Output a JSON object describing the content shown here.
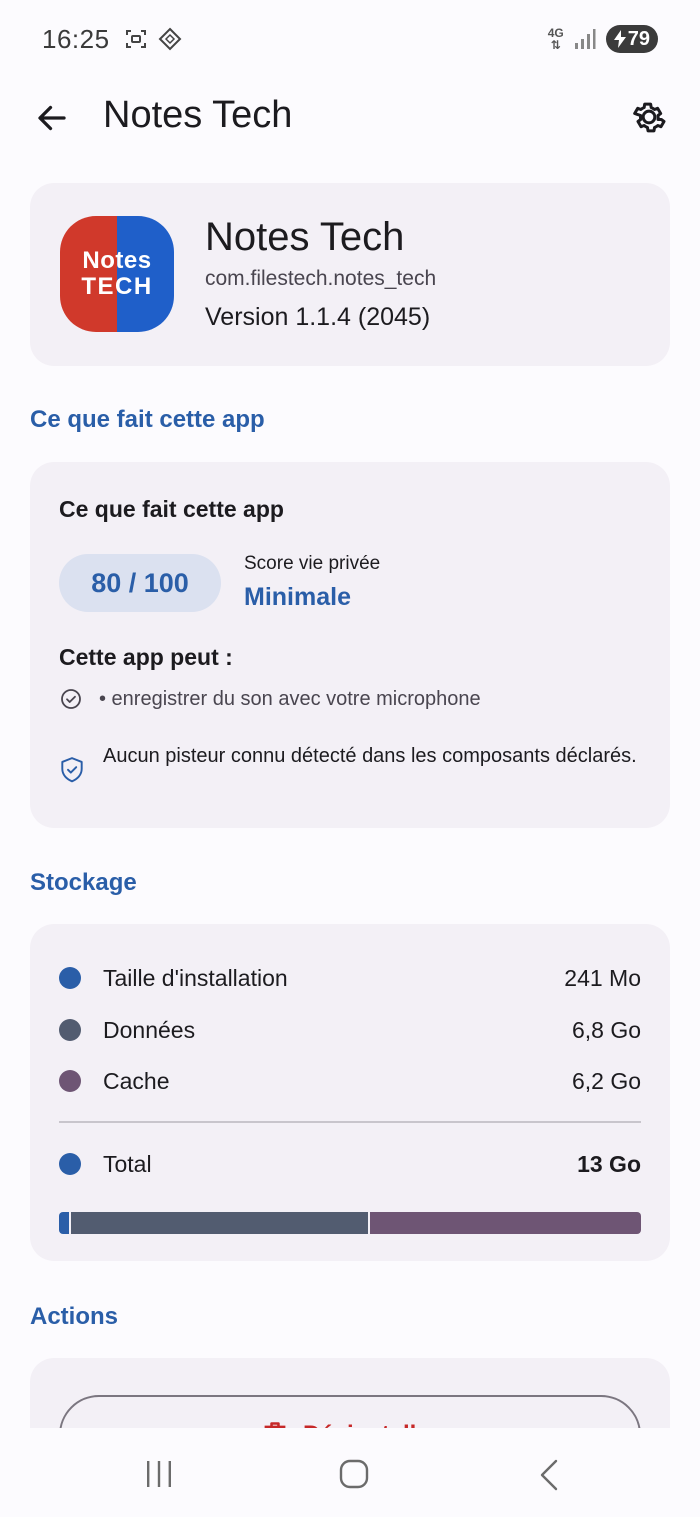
{
  "status_bar": {
    "time": "16:25",
    "network": "4G",
    "battery": "79",
    "icons": [
      "screenshot-icon",
      "nfc-icon",
      "signal-icon",
      "charging-icon"
    ]
  },
  "app_bar": {
    "title": "Notes Tech",
    "back_icon": "arrow-left-icon",
    "settings_icon": "gear-icon"
  },
  "app_header": {
    "name": "Notes Tech",
    "package": "com.filestech.notes_tech",
    "version": "Version 1.1.4 (2045)",
    "logo_line1": "Notes",
    "logo_line2": "TECH"
  },
  "privacy": {
    "section_title": "Ce que fait cette app",
    "card_heading": "Ce que fait cette app",
    "score": "80 / 100",
    "score_label": "Score vie privée",
    "score_value": "Minimale",
    "can_heading": "Cette app peut :",
    "permissions": [
      "• enregistrer du son avec votre microphone"
    ],
    "tracker_note": "Aucun pisteur connu détecté dans les composants déclarés."
  },
  "storage": {
    "section_title": "Stockage",
    "rows": [
      {
        "label": "Taille d'installation",
        "value": "241 Mo",
        "color": "#2a5ea8"
      },
      {
        "label": "Données",
        "value": "6,8 Go",
        "color": "#525c70"
      },
      {
        "label": "Cache",
        "value": "6,2 Go",
        "color": "#6e5574"
      }
    ],
    "total": {
      "label": "Total",
      "value": "13 Go",
      "color": "#2a5ea8"
    },
    "bar_fractions": [
      0.018,
      0.514,
      0.468
    ]
  },
  "actions": {
    "section_title": "Actions",
    "uninstall_label": "Désinstaller"
  },
  "colors": {
    "accent": "#2a5ea8",
    "danger": "#c62828",
    "card_bg": "#f3f0f6"
  }
}
